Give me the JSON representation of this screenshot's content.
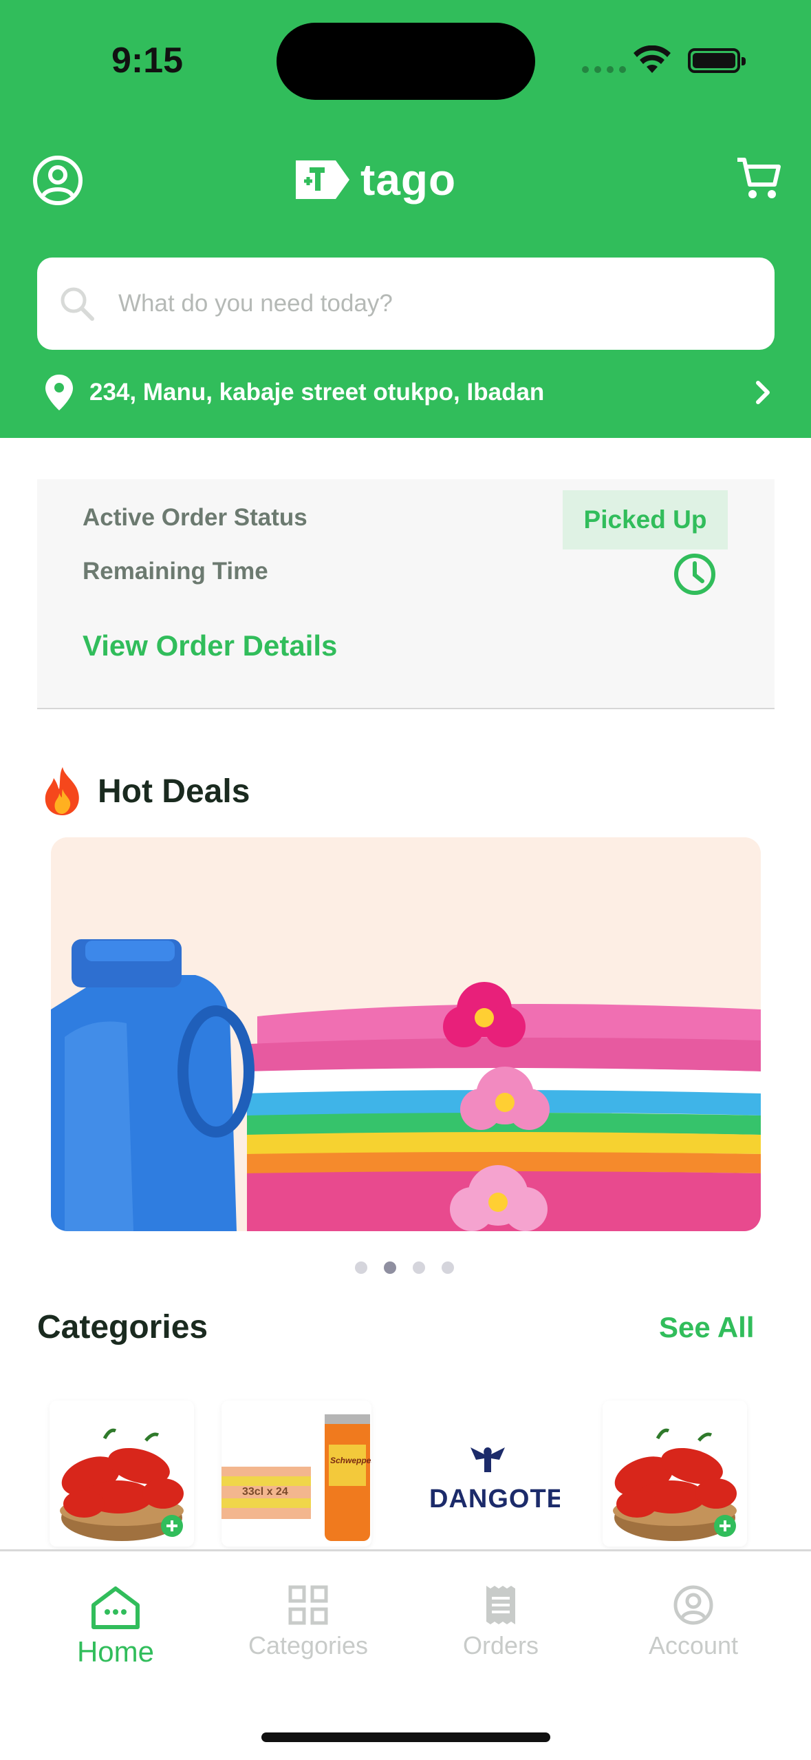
{
  "status_bar": {
    "time": "9:15"
  },
  "header": {
    "brand": "tago",
    "search": {
      "placeholder": "What do you need today?"
    },
    "address": "234, Manu, kabaje street otukpo, Ibadan",
    "icons": [
      "user-circle-icon",
      "tago-logo-icon",
      "cart-icon",
      "search-icon",
      "location-pin-icon",
      "chevron-right-icon"
    ]
  },
  "order_card": {
    "status_label": "Active Order Status",
    "status_value": "Picked Up",
    "time_label": "Remaining Time",
    "link": "View Order Details"
  },
  "hot_deals": {
    "title": "Hot Deals",
    "icon": "fire-icon",
    "carousel": {
      "total": 4,
      "active_index": 1
    }
  },
  "categories": {
    "title": "Categories",
    "see_all": "See All",
    "items": [
      {
        "name": "peppers-basket",
        "brand": ""
      },
      {
        "name": "schweppes-pack",
        "brand": "Schweppes",
        "pack_label": "33cl x 24"
      },
      {
        "name": "dangote",
        "brand": "DANGOTE"
      },
      {
        "name": "peppers-basket-2",
        "brand": ""
      }
    ]
  },
  "tabbar": {
    "tabs": [
      {
        "label": "Home",
        "icon": "home-icon",
        "active": true
      },
      {
        "label": "Categories",
        "icon": "grid-icon",
        "active": false
      },
      {
        "label": "Orders",
        "icon": "receipt-icon",
        "active": false
      },
      {
        "label": "Account",
        "icon": "user-circle-icon",
        "active": false
      }
    ]
  },
  "colors": {
    "brand_green": "#31bd5b",
    "badge_bg": "#dff2e4",
    "muted_text": "#6c7a70",
    "inactive_tab": "#c8cbc9"
  }
}
